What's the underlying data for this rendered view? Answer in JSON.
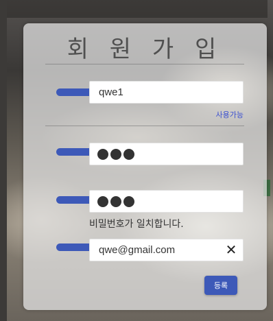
{
  "form": {
    "title": "회 원 가 입",
    "id_field": {
      "value": "qwe1",
      "status": "사용가능"
    },
    "password_field": {
      "masked": "●●●"
    },
    "password_confirm_field": {
      "masked": "●●●",
      "message": "비밀번호가 일치합니다."
    },
    "email_field": {
      "value": "qwe@gmail.com",
      "clear_icon": "close-icon"
    },
    "submit_label": "등록"
  },
  "colors": {
    "accent": "#3d59b8",
    "status_text": "#3a4fd0"
  }
}
